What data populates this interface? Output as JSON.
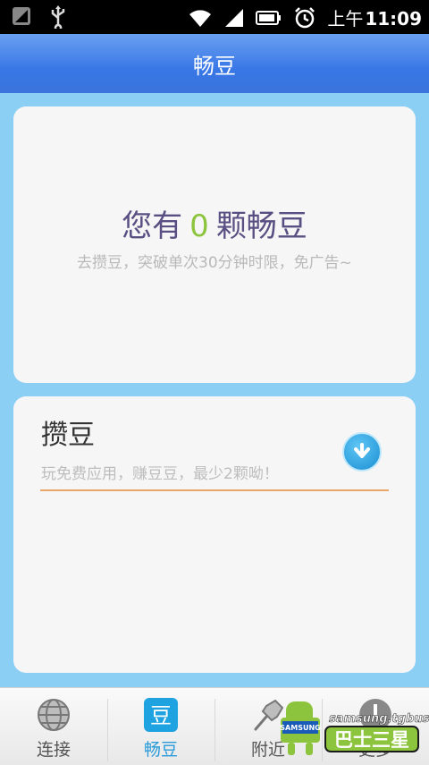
{
  "status_bar": {
    "time_prefix": "上午",
    "time": "11:09",
    "icons": [
      "signal-status-icon",
      "usb-icon",
      "wifi-icon",
      "cell-signal-icon",
      "battery-icon",
      "alarm-icon"
    ]
  },
  "header": {
    "title": "畅豆"
  },
  "beans_card": {
    "prefix": "您有",
    "count": "0",
    "suffix": "颗畅豆",
    "subtitle": "去攒豆，突破单次30分钟时限，免广告~"
  },
  "earn_card": {
    "title": "攒豆",
    "subtitle": "玩免费应用，赚豆豆，最少2颗呦！",
    "action_icon": "download-icon"
  },
  "tabs": [
    {
      "label": "连接",
      "icon": "globe-icon",
      "active": false
    },
    {
      "label": "畅豆",
      "icon": "bean-icon",
      "active": true,
      "icon_text": "豆"
    },
    {
      "label": "附近",
      "icon": "pin-icon",
      "active": false
    },
    {
      "label": "更多",
      "icon": "more-icon",
      "active": false
    }
  ],
  "watermark": {
    "brand": "SAMSUNG",
    "site": "samsung.tgbus.com",
    "text": "巴士三星"
  },
  "colors": {
    "header": "#3877e6",
    "background": "#8ccff5",
    "accent_number": "#8cc43e",
    "active_tab": "#2a9bd8",
    "underline": "#e9a76a"
  }
}
